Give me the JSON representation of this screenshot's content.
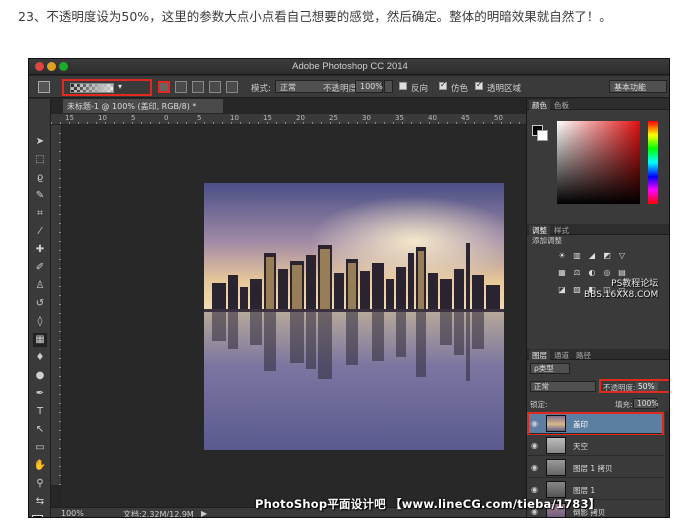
{
  "caption": "23、不透明度设为50%，这里的参数大点小点看自己想要的感觉，然后确定。整体的明暗效果就自然了！。",
  "app": {
    "title": "Adobe Photoshop CC 2014"
  },
  "options_bar": {
    "mode_label": "模式:",
    "mode_value": "正常",
    "opacity_label": "不透明度:",
    "opacity_value": "100%",
    "reverse_label": "反向",
    "dither_label": "仿色",
    "transparency_label": "透明区域",
    "workspace_value": "基本功能",
    "highlight_color": "#e02a1d"
  },
  "document": {
    "tab_title": "未标题-1 @ 100% (盖印, RGB/8) *",
    "ruler_ticks": [
      "15",
      "10",
      "5",
      "0",
      "5",
      "10",
      "15",
      "20",
      "25",
      "30",
      "35",
      "40",
      "45",
      "50"
    ]
  },
  "status": {
    "zoom": "100%",
    "doc_size": "文档:2.32M/12.9M",
    "arrow": "▶"
  },
  "watermark": "PhotoShop平面设计吧 【www.lineCG.com/tieba/1783】",
  "forum_mark": {
    "line1": "PS教程论坛",
    "line2": "BBS.16XX8.COM"
  },
  "panels": {
    "color_tabs": [
      "颜色",
      "色板"
    ],
    "adjust_tabs": [
      "调整",
      "样式"
    ],
    "adjust_title": "添加调整",
    "layer_tabs": [
      "图层",
      "通道",
      "路径"
    ],
    "kind_filter": "ρ类型",
    "blend_mode": "正常",
    "opacity_label": "不透明度:",
    "opacity_value": "50%",
    "lock_label": "锁定:",
    "fill_label": "填充:",
    "fill_value": "100%"
  },
  "layers": [
    {
      "name": "盖印",
      "selected": true
    },
    {
      "name": "天空",
      "selected": false
    },
    {
      "name": "图层 1 拷贝",
      "selected": false
    },
    {
      "name": "图层 1",
      "selected": false
    },
    {
      "name": "倒影 拷贝",
      "selected": false
    }
  ]
}
